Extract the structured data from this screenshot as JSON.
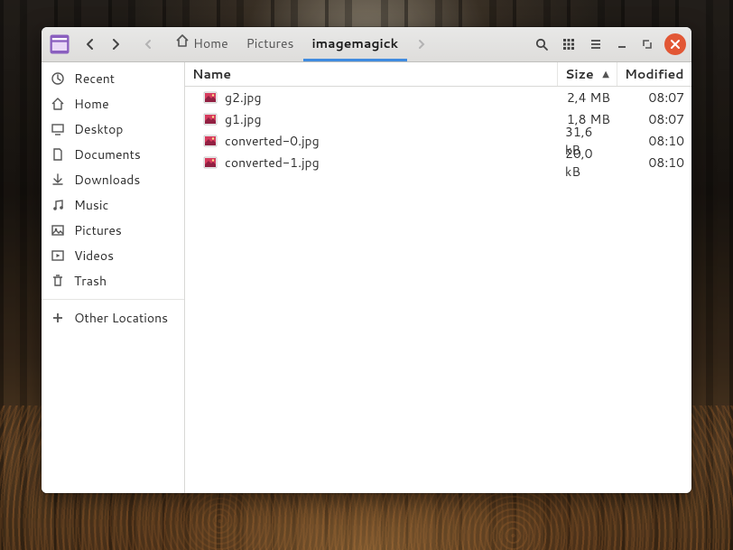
{
  "breadcrumb": {
    "home": "Home",
    "pictures": "Pictures",
    "current": "imagemagick"
  },
  "sidebar": {
    "items": [
      {
        "icon": "clock",
        "label": "Recent"
      },
      {
        "icon": "home",
        "label": "Home"
      },
      {
        "icon": "desktop",
        "label": "Desktop"
      },
      {
        "icon": "documents",
        "label": "Documents"
      },
      {
        "icon": "downloads",
        "label": "Downloads"
      },
      {
        "icon": "music",
        "label": "Music"
      },
      {
        "icon": "pictures",
        "label": "Pictures"
      },
      {
        "icon": "videos",
        "label": "Videos"
      },
      {
        "icon": "trash",
        "label": "Trash"
      }
    ],
    "other_locations": "Other Locations"
  },
  "columns": {
    "name": "Name",
    "size": "Size",
    "modified": "Modified",
    "sort": "▲"
  },
  "files": [
    {
      "name": "g2.jpg",
      "size": "2,4 MB",
      "modified": "08:07"
    },
    {
      "name": "g1.jpg",
      "size": "1,8 MB",
      "modified": "08:07"
    },
    {
      "name": "converted-0.jpg",
      "size": "31,6 kB",
      "modified": "08:10"
    },
    {
      "name": "converted-1.jpg",
      "size": "20,0 kB",
      "modified": "08:10"
    }
  ]
}
